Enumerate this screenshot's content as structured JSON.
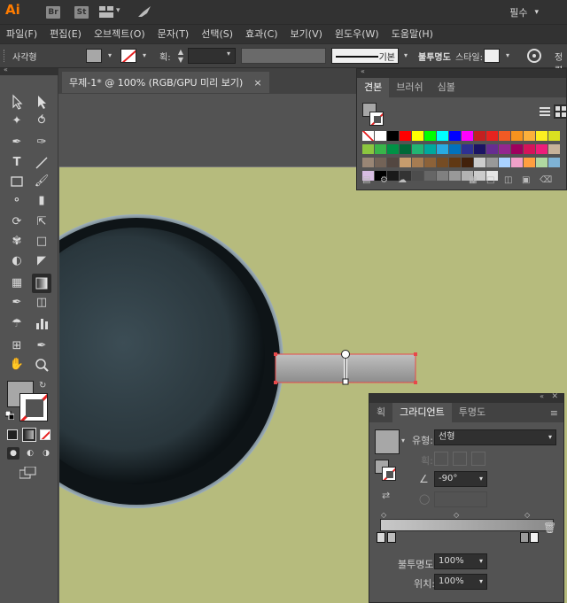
{
  "appbar": {
    "logo": "Ai",
    "icons": [
      "Br",
      "St"
    ],
    "workspace": "필수"
  },
  "menu": [
    "파일(F)",
    "편집(E)",
    "오브젝트(O)",
    "문자(T)",
    "선택(S)",
    "효과(C)",
    "보기(V)",
    "윈도우(W)",
    "도움말(H)"
  ],
  "controlbar": {
    "object_type": "사각형",
    "stroke_label": "획:",
    "stroke_style_value": "기본",
    "opacity_label": "불투명도",
    "style_label": "스타일:",
    "extra_label": "정렬"
  },
  "document_tab": {
    "title": "무제-1* @ 100% (RGB/GPU 미리 보기)",
    "close": "×"
  },
  "swatches_panel": {
    "tabs": [
      "견본",
      "브러쉬",
      "심볼"
    ],
    "colors_row1": [
      "#ffffff",
      "#000000",
      "#ff0000",
      "#ffff00",
      "#00ff00",
      "#00ffff",
      "#0000ff",
      "#ff00ff",
      "#c42020",
      "#e7231f",
      "#f15a24",
      "#f7931e",
      "#fbb03b",
      "#fcee21",
      "#d9e021",
      "#8cc63f"
    ],
    "colors_row2": [
      "#39b54a",
      "#009245",
      "#006837",
      "#22b573",
      "#00a99d",
      "#29abe2",
      "#0071bc",
      "#2e3192",
      "#1b1464",
      "#662d91",
      "#93278f",
      "#9e005d",
      "#d4145a",
      "#ed1e79",
      "#c7b299",
      "#998675"
    ],
    "colors_row3": [
      "#736357",
      "#534741",
      "#c69c6d",
      "#a67c52",
      "#8c6239",
      "#754c24",
      "#603813",
      "#42210b",
      "#cccccc",
      "#999999",
      "#aad2ff",
      "#f0a0c8",
      "#ff9f40",
      "#b0d8a0",
      "#7fb3d5",
      "#d7bde2"
    ],
    "colors_row4": [
      "#000000",
      "#1a1a1a",
      "#333333",
      "#4d4d4d",
      "#666666",
      "#808080",
      "#999999",
      "#b3b3b3",
      "#cccccc",
      "#e6e6e6"
    ]
  },
  "gradient_panel": {
    "tabs": [
      "획",
      "그라디언트",
      "투명도"
    ],
    "type_label": "유형:",
    "type_value": "선형",
    "stroke_label": "획:",
    "angle_value": "-90°",
    "opacity_label": "불투명도:",
    "opacity_value": "100%",
    "location_label": "위치:",
    "location_value": "100%"
  },
  "colors": {
    "artboard": "#b6bb7d",
    "accent": "#ff7c00",
    "selection": "#e8484a",
    "pan_dark": "#1d2a30"
  }
}
